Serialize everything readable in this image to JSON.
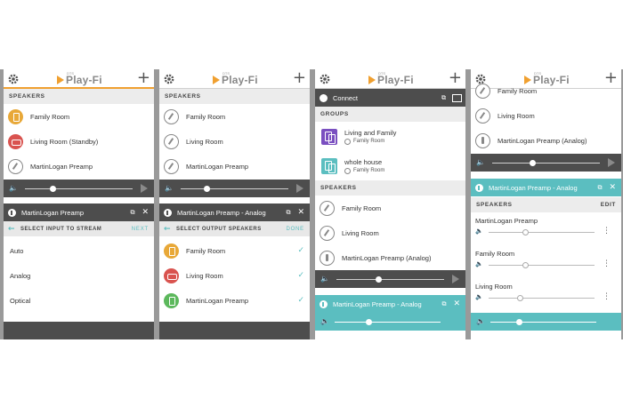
{
  "brand": {
    "logo": "Play-Fi",
    "logo_sup": "DTS",
    "accent": "#f0a030",
    "teal": "#5bbec0"
  },
  "panel1": {
    "section": "SPEAKERS",
    "speakers": [
      "Family Room",
      "Living Room (Standby)",
      "MartinLogan Preamp"
    ],
    "device_header": "MartinLogan Preamp",
    "sub_title": "SELECT INPUT TO STREAM",
    "sub_action": "NEXT",
    "inputs": [
      "Auto",
      "Analog",
      "Optical"
    ]
  },
  "panel2": {
    "section": "SPEAKERS",
    "speakers": [
      "Family Room",
      "Living Room",
      "MartinLogan Preamp"
    ],
    "device_header": "MartinLogan Preamp - Analog",
    "sub_title": "SELECT OUTPUT SPEAKERS",
    "sub_action": "DONE",
    "outputs": [
      "Family Room",
      "Living Room",
      "MartinLogan Preamp"
    ]
  },
  "panel3": {
    "connect": "Connect",
    "groups_section": "GROUPS",
    "groups": [
      {
        "name": "Living and Family",
        "sub": "Family Room"
      },
      {
        "name": "whole house",
        "sub": "Family Room"
      }
    ],
    "speakers_section": "SPEAKERS",
    "speakers": [
      "Family Room",
      "Living Room",
      "MartinLogan Preamp (Analog)"
    ],
    "device_header": "MartinLogan Preamp - Analog"
  },
  "panel4": {
    "speakers": [
      "Family Room",
      "Living Room",
      "MartinLogan Preamp (Analog)"
    ],
    "device_header": "MartinLogan Preamp - Analog",
    "section": "SPEAKERS",
    "edit": "EDIT",
    "group_speakers": [
      {
        "name": "MartinLogan Preamp",
        "level": 0.35
      },
      {
        "name": "Family Room",
        "level": 0.35
      },
      {
        "name": "Living Room",
        "level": 0.3
      }
    ]
  }
}
